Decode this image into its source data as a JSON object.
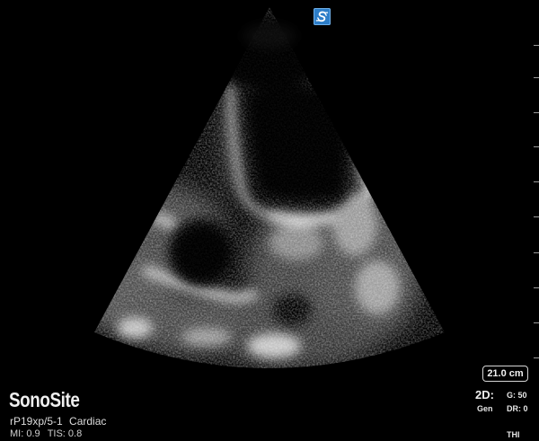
{
  "brand": {
    "name": "SonoSite"
  },
  "orientation_marker": {
    "icon": "sonosite-orientation-marker-icon",
    "color": "#2c7dc8"
  },
  "probe": {
    "transducer": "rP19xp/5-1",
    "exam_preset": "Cardiac"
  },
  "indices": {
    "mi": "MI: 0.9",
    "tis": "TIS: 0.8"
  },
  "depth": {
    "value": "21.0 cm"
  },
  "mode": {
    "name": "2D:",
    "optimization": "Gen",
    "gain": "G: 50",
    "dynamic_range": "DR: 0",
    "harmonics": "THI"
  },
  "image": {
    "description_icon": "cardiac-echo-sector-image",
    "background_color": "#000000"
  }
}
